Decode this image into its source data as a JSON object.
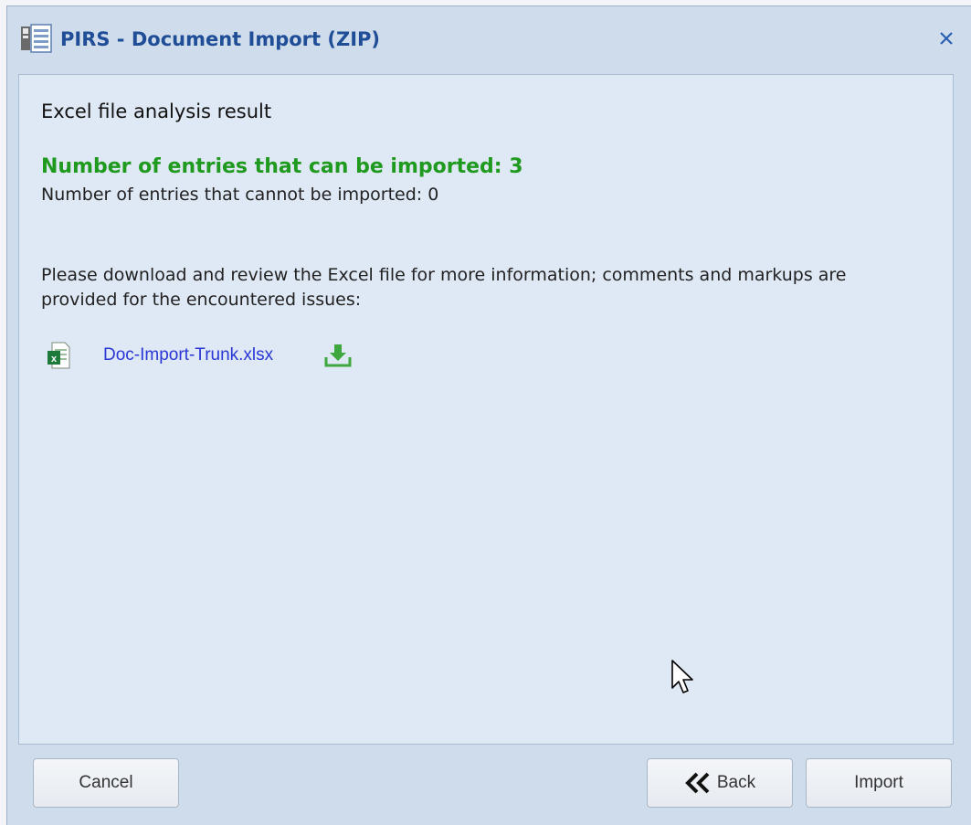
{
  "window": {
    "title": "PIRS - Document Import (ZIP)",
    "icon": "document-import-icon",
    "close_icon": "close-icon"
  },
  "content": {
    "heading": "Excel file analysis result",
    "importable_label": "Number of entries that can be imported: 3",
    "not_importable_label": "Number of entries that cannot be imported: 0",
    "info_text": "Please download and review the Excel file for more information; comments and markups are provided for the encountered issues:",
    "file": {
      "name": "Doc-Import-Trunk.xlsx",
      "icon": "excel-file-icon",
      "download_icon": "download-icon"
    }
  },
  "footer": {
    "cancel_label": "Cancel",
    "back_label": "Back",
    "import_label": "Import"
  },
  "colors": {
    "title": "#1f4e97",
    "success": "#1f9a1f",
    "link": "#2a37d6",
    "panel": "#dfe8f5",
    "frame": "#cfdcec"
  }
}
